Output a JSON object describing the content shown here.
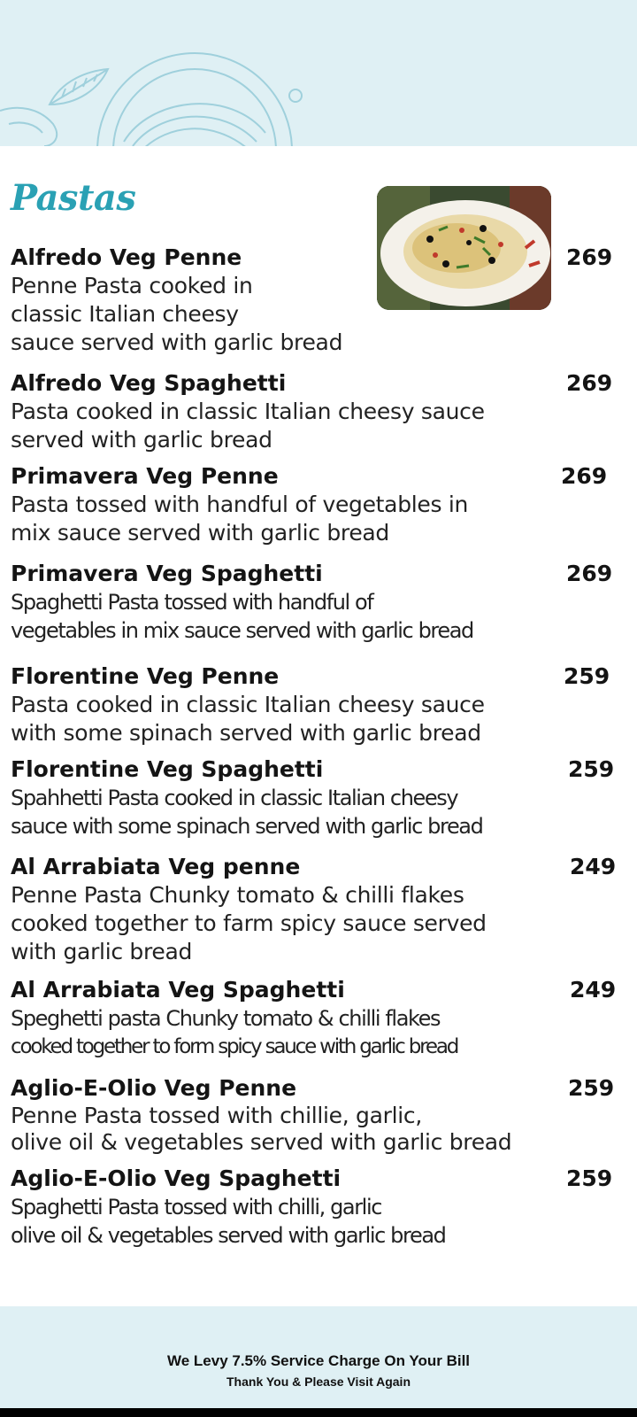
{
  "section": {
    "title": "Pastas"
  },
  "items": [
    {
      "name": "Alfredo Veg Penne",
      "price": "269",
      "desc": [
        "Penne Pasta cooked in",
        "classic Italian cheesy",
        "sauce served with garlic bread"
      ]
    },
    {
      "name": "Alfredo Veg Spaghetti",
      "price": "269",
      "desc": [
        "Pasta cooked in classic Italian cheesy sauce",
        "served with garlic bread"
      ]
    },
    {
      "name": "Primavera Veg Penne",
      "price": "269",
      "desc": [
        "Pasta tossed with handful of vegetables in",
        "mix sauce served with garlic bread"
      ]
    },
    {
      "name": "Primavera Veg Spaghetti",
      "price": "269",
      "desc": [
        "Spaghetti Pasta tossed with handful of",
        "vegetables in mix sauce served with garlic bread"
      ]
    },
    {
      "name": "Florentine Veg Penne",
      "price": "259",
      "desc": [
        "Pasta cooked in classic Italian cheesy sauce",
        "with some spinach served with garlic bread"
      ]
    },
    {
      "name": "Florentine Veg Spaghetti",
      "price": "259",
      "desc": [
        "Spahhetti Pasta cooked in classic Italian cheesy",
        "sauce with some spinach served with garlic bread"
      ]
    },
    {
      "name": "Al Arrabiata Veg penne",
      "price": "249",
      "desc": [
        "Penne Pasta Chunky tomato & chilli flakes",
        "cooked together to farm spicy sauce served",
        "with garlic bread"
      ]
    },
    {
      "name": "Al Arrabiata Veg Spaghetti",
      "price": "249",
      "desc": [
        "Speghetti pasta Chunky tomato & chilli flakes",
        "cooked together to form spicy sauce with garlic bread"
      ]
    },
    {
      "name": "Aglio-E-Olio Veg Penne",
      "price": "259",
      "desc": [
        "Penne Pasta tossed with chillie, garlic,",
        "olive oil & vegetables served with garlic bread"
      ]
    },
    {
      "name": "Aglio-E-Olio Veg Spaghetti",
      "price": "259",
      "desc": [
        "Spaghetti Pasta tossed with chilli, garlic",
        "olive oil & vegetables served with garlic bread"
      ]
    }
  ],
  "footer": {
    "service_charge": "We Levy 7.5% Service Charge On Your Bill",
    "thanks": "Thank You & Please Visit Again"
  },
  "colors": {
    "accent": "#2aa1b4",
    "band": "#dff0f4"
  }
}
